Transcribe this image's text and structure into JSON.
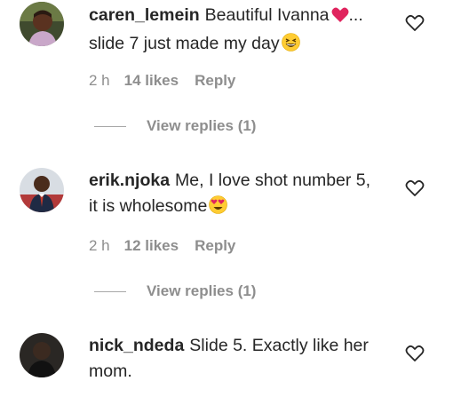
{
  "comments": [
    {
      "username": "caren_lemein",
      "text_line1": "Beautiful Ivanna",
      "line1_suffix": "...",
      "text_line2": "slide 7 just made my day",
      "emoji1": "red-heart-emoji",
      "emoji2": "grinning-squinting-face-emoji",
      "time": "2 h",
      "likes": "14 likes",
      "reply": "Reply",
      "view_replies": "View replies (1)"
    },
    {
      "username": "erik.njoka",
      "text_line1": "Me, I love shot number 5,",
      "text_line2": "it is wholesome",
      "emoji1": "smiling-face-with-heart-eyes-emoji",
      "time": "2 h",
      "likes": "12 likes",
      "reply": "Reply",
      "view_replies": "View replies (1)"
    },
    {
      "username": "nick_ndeda",
      "text_line1": "Slide 5. Exactly like her",
      "text_line2": "mom."
    }
  ],
  "icons": {
    "like": "heart-outline-icon"
  },
  "colors": {
    "text": "#262626",
    "muted": "#8e8e8e",
    "heart_emoji": "#e0245e",
    "emoji_face": "#ffcc33"
  }
}
